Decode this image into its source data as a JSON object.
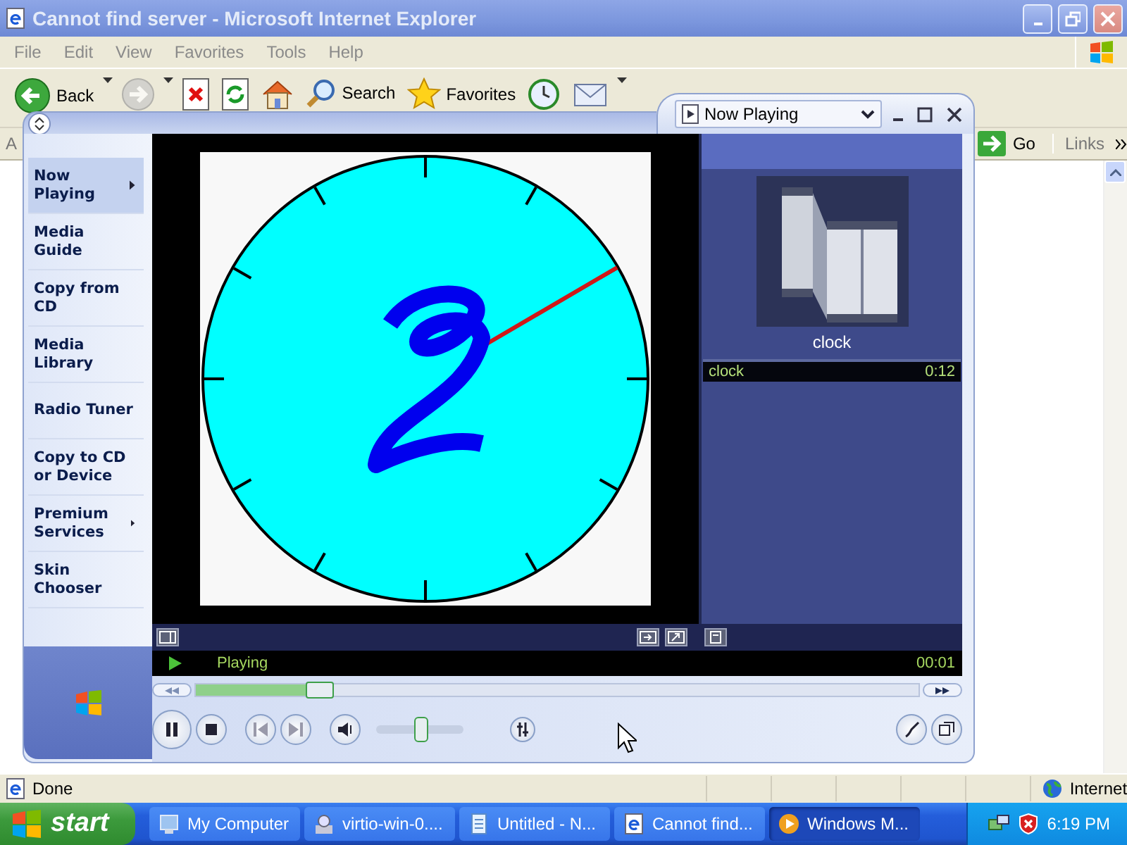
{
  "ie_window": {
    "title": "Cannot find server - Microsoft Internet Explorer",
    "menu": [
      "File",
      "Edit",
      "View",
      "Favorites",
      "Tools",
      "Help"
    ],
    "toolbar": [
      {
        "kind": "back",
        "label": "Back",
        "disabled": false,
        "dropdown": true
      },
      {
        "kind": "forward",
        "disabled": true,
        "dropdown": true
      },
      {
        "kind": "stop",
        "disabled": false,
        "dropdown": false
      },
      {
        "kind": "refresh",
        "disabled": false,
        "dropdown": false
      },
      {
        "kind": "home",
        "disabled": false,
        "dropdown": false
      },
      {
        "kind": "search",
        "label": "Search",
        "disabled": false,
        "dropdown": false
      },
      {
        "kind": "favorites",
        "label": "Favorites",
        "disabled": false,
        "dropdown": false
      },
      {
        "kind": "history",
        "disabled": false,
        "dropdown": false
      },
      {
        "kind": "mail",
        "disabled": false,
        "dropdown": true
      }
    ],
    "address_label": "A",
    "go": "Go",
    "links": "Links",
    "status": "Done",
    "zone": "Internet"
  },
  "player": {
    "view": "Now Playing",
    "menu": [
      {
        "label": "Now Playing",
        "selected": true,
        "has_submenu": true
      },
      {
        "label": "Media Guide",
        "selected": false,
        "has_submenu": false
      },
      {
        "label": "Copy from CD",
        "selected": false,
        "has_submenu": false
      },
      {
        "label": "Media Library",
        "selected": false,
        "has_submenu": false
      },
      {
        "label": "Radio Tuner",
        "selected": false,
        "has_submenu": false
      },
      {
        "label": "Copy to CD or Device",
        "selected": false,
        "has_submenu": false
      },
      {
        "label": "Premium Services",
        "selected": false,
        "has_submenu": true
      },
      {
        "label": "Skin Chooser",
        "selected": false,
        "has_submenu": false
      }
    ],
    "album_caption": "clock",
    "playlist": [
      {
        "title": "clock",
        "duration": "0:12",
        "selected": true
      }
    ],
    "playing": true,
    "state": "Playing",
    "elapsed": "00:01",
    "seek": {
      "level": 0.17
    },
    "volume": {
      "level": 0.5
    }
  },
  "taskbar": {
    "start": "start",
    "buttons": [
      {
        "kind": "computer",
        "label": "My Computer",
        "selected": false
      },
      {
        "kind": "installer",
        "label": "virtio-win-0....",
        "selected": false
      },
      {
        "kind": "notepad",
        "label": "Untitled - N...",
        "selected": false
      },
      {
        "kind": "ie",
        "label": "Cannot find...",
        "selected": false
      },
      {
        "kind": "wmp",
        "label": "Windows M...",
        "selected": true
      }
    ],
    "clock": "6:19 PM"
  }
}
